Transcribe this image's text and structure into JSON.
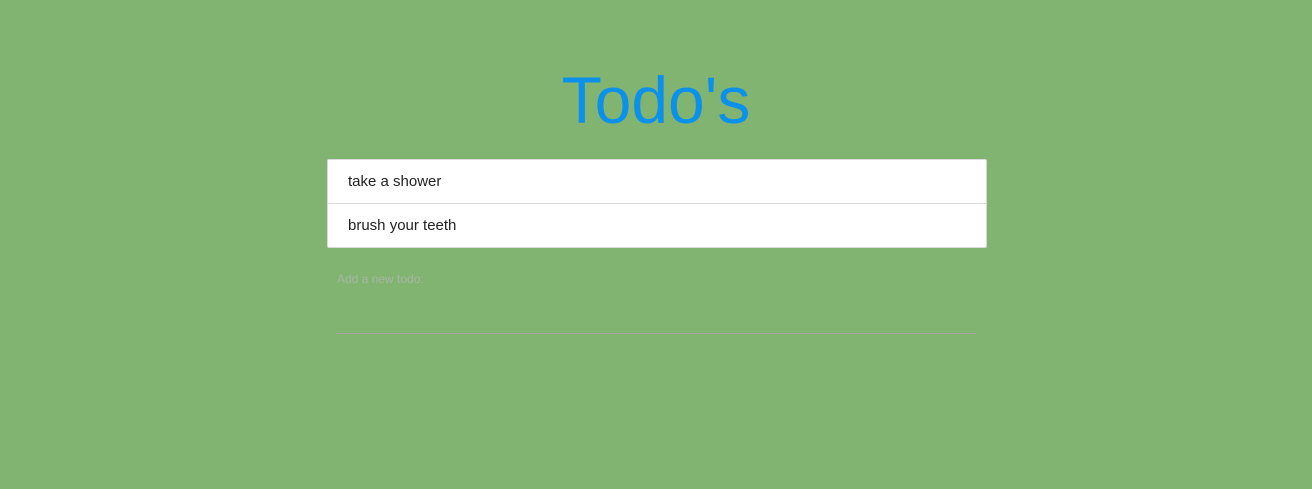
{
  "header": {
    "title": "Todo's"
  },
  "todos": [
    {
      "text": "take a shower"
    },
    {
      "text": "brush your teeth"
    }
  ],
  "new_todo": {
    "label": "Add a new todo:",
    "value": ""
  },
  "colors": {
    "background": "#81b471",
    "title": "#0b91e9",
    "card": "#ffffff",
    "divider": "#d9d9d9"
  }
}
